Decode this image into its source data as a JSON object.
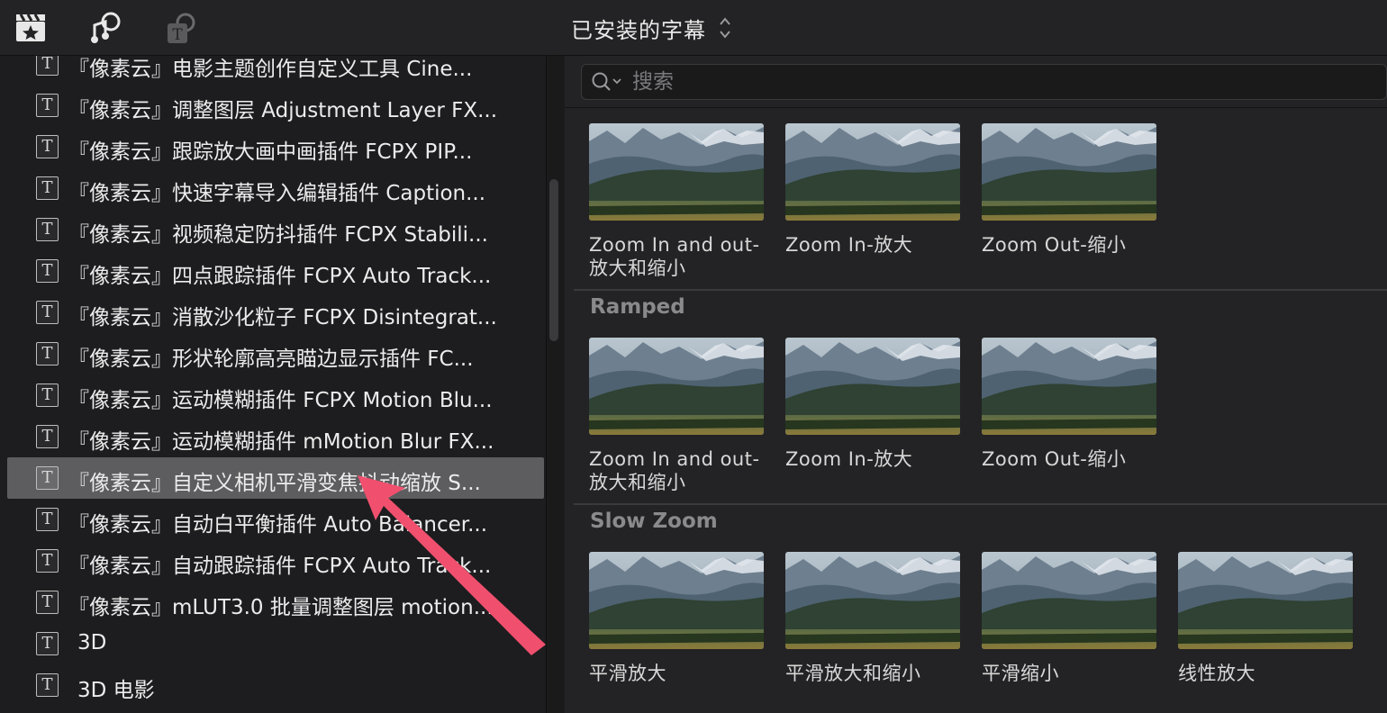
{
  "topbar": {
    "icons": [
      "clapper-star-icon",
      "music-photo-icon",
      "titles-icon"
    ],
    "title": "已安装的字幕"
  },
  "sidebar": {
    "items": [
      {
        "label": "『像素云』电影主题创作自定义工具 Cine..."
      },
      {
        "label": "『像素云』调整图层 Adjustment Layer FX..."
      },
      {
        "label": "『像素云』跟踪放大画中画插件 FCPX PIP..."
      },
      {
        "label": "『像素云』快速字幕导入编辑插件 Caption..."
      },
      {
        "label": "『像素云』视频稳定防抖插件 FCPX Stabili..."
      },
      {
        "label": "『像素云』四点跟踪插件 FCPX Auto Track..."
      },
      {
        "label": "『像素云』消散沙化粒子 FCPX Disintegrat..."
      },
      {
        "label": "『像素云』形状轮廓高亮瞄边显示插件 FC..."
      },
      {
        "label": "『像素云』运动模糊插件 FCPX Motion Blu..."
      },
      {
        "label": "『像素云』运动模糊插件 mMotion Blur FX..."
      },
      {
        "label": "『像素云』自定义相机平滑变焦抖动缩放 S...",
        "selected": true
      },
      {
        "label": "『像素云』自动白平衡插件 Auto Balancer..."
      },
      {
        "label": "『像素云』自动跟踪插件 FCPX Auto Track..."
      },
      {
        "label": "『像素云』mLUT3.0 批量调整图层 motion..."
      },
      {
        "label": "3D"
      },
      {
        "label": "3D 电影"
      }
    ]
  },
  "search": {
    "placeholder": "搜索"
  },
  "sections": [
    {
      "title": "",
      "tiles": [
        {
          "label": "Zoom In and out-放大和缩小"
        },
        {
          "label": "Zoom In-放大"
        },
        {
          "label": "Zoom Out-缩小"
        }
      ]
    },
    {
      "title": "Ramped",
      "tiles": [
        {
          "label": "Zoom In and out-放大和缩小"
        },
        {
          "label": "Zoom In-放大"
        },
        {
          "label": "Zoom Out-缩小"
        }
      ]
    },
    {
      "title": "Slow Zoom",
      "tiles": [
        {
          "label": "平滑放大"
        },
        {
          "label": "平滑放大和缩小"
        },
        {
          "label": "平滑缩小"
        },
        {
          "label": "线性放大"
        }
      ]
    }
  ],
  "annotation": {
    "color": "#f0506e"
  }
}
